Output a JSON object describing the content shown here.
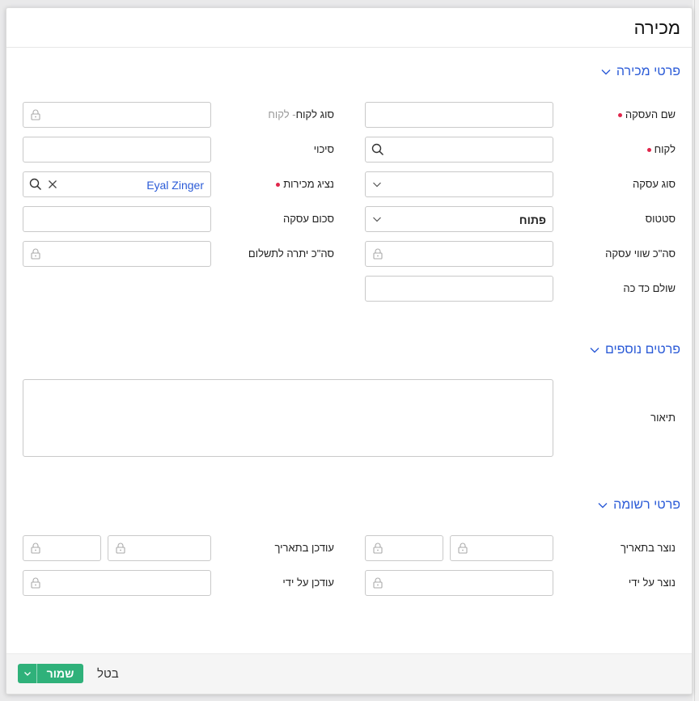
{
  "dialog": {
    "title": "מכירה"
  },
  "sections": {
    "sale_details": "פרטי מכירה",
    "more_details": "פרטים נוספים",
    "record_details": "פרטי רשומה"
  },
  "labels": {
    "deal_name": "שם העסקה",
    "customer": "לקוח",
    "deal_type": "סוג עסקה",
    "status": "סטטוס",
    "total_deal_value": "סה\"כ שווי עסקה",
    "paid_so_far": "שולם כד כה",
    "customer_type": "סוג לקוח",
    "customer_type_sub": "- לקוח",
    "chance": "סיכוי",
    "sales_rep": "נציג מכירות",
    "deal_amount": "סכום עסקה",
    "total_balance_due": "סה\"כ יתרה לתשלום",
    "description": "תיאור",
    "created_on": "נוצר בתאריך",
    "updated_on": "עודכן בתאריך",
    "created_by": "נוצר על ידי",
    "updated_by": "עודכן על ידי"
  },
  "values": {
    "status": "פתוח",
    "sales_rep": "Eyal Zinger"
  },
  "footer": {
    "save": "שמור",
    "cancel": "בטל"
  },
  "colors": {
    "accent": "#2b5bd7",
    "required": "#e0264b",
    "save": "#2fb17a"
  }
}
